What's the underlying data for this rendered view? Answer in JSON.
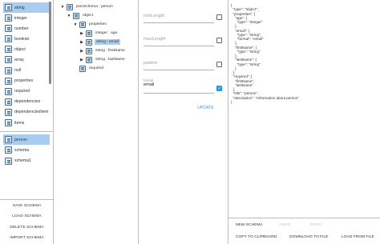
{
  "palette": {
    "items": [
      {
        "label": "string",
        "selected": true
      },
      {
        "label": "integer",
        "selected": false
      },
      {
        "label": "number",
        "selected": false
      },
      {
        "label": "boolean",
        "selected": false
      },
      {
        "label": "object",
        "selected": false
      },
      {
        "label": "array",
        "selected": false
      },
      {
        "label": "null",
        "selected": false
      },
      {
        "label": "properties",
        "selected": false
      },
      {
        "label": "required",
        "selected": false
      },
      {
        "label": "dependencies",
        "selected": false
      },
      {
        "label": "dependenciesItem",
        "selected": false
      },
      {
        "label": "items",
        "selected": false
      }
    ]
  },
  "schemas": {
    "items": [
      {
        "label": "person",
        "selected": true
      },
      {
        "label": "schema",
        "selected": false
      },
      {
        "label": "schema1",
        "selected": false
      }
    ]
  },
  "left_actions": {
    "save": "SAVE SCHEMA",
    "load": "LOAD SCHEMA",
    "delete": "DELETE SCHEMA",
    "import": "IMPORT SCHEMA"
  },
  "tree": {
    "rows": [
      {
        "label": "jsonSchema : person",
        "twisty": "▼",
        "depth": 0,
        "selected": false
      },
      {
        "label": "object",
        "twisty": "▼",
        "depth": 1,
        "selected": false
      },
      {
        "label": "properties",
        "twisty": "▼",
        "depth": 2,
        "selected": false
      },
      {
        "label": "integer : age",
        "twisty": "▶",
        "depth": 3,
        "selected": false
      },
      {
        "label": "string : email",
        "twisty": "▶",
        "depth": 3,
        "selected": true
      },
      {
        "label": "string : firstName",
        "twisty": "▶",
        "depth": 3,
        "selected": false
      },
      {
        "label": "string : lastName",
        "twisty": "▶",
        "depth": 3,
        "selected": false
      },
      {
        "label": "required",
        "twisty": "",
        "depth": 2,
        "selected": false
      }
    ]
  },
  "props": {
    "minLength": {
      "placeholder": "minLength",
      "checked": false
    },
    "maxLength": {
      "placeholder": "maxLength",
      "checked": false
    },
    "pattern": {
      "placeholder": "pattern",
      "checked": false
    },
    "format": {
      "label": "format",
      "value": "email",
      "checked": true
    },
    "update": "UPDATE"
  },
  "code": {
    "text": "{\n  \"type\": \"object\",\n  \"properties\": {\n    \"age\": {\n      \"type\": \"integer\"\n    },\n    \"email\": {\n      \"type\": \"string\",\n      \"format\": \"email\"\n    },\n    \"firstName\": {\n      \"type\": \"string\"\n    },\n    \"lastName\": {\n      \"type\": \"string\"\n    }\n  },\n  \"required\": [\n    \"firstName\",\n    \"lastName\"\n  ],\n  \"title\": \"person\",\n  \"description\": \"Information about person\"\n}"
  },
  "code_actions": {
    "new_schema": "NEW SCHEMA",
    "undo": "UNDO",
    "redo": "REDO",
    "copy": "COPY TO CLIPBOARD",
    "download": "DOWNLOAD TO FILE",
    "load_file": "LOAD FROM FILE"
  },
  "colors": {
    "selection": "#a9cdf0",
    "accent": "#2196f3",
    "update_text": "#4a9ae0"
  }
}
